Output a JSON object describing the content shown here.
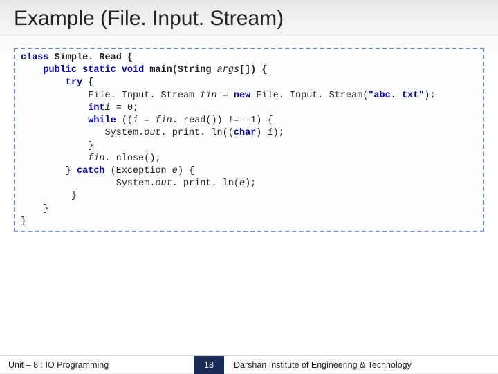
{
  "slide": {
    "title": "Example (File. Input. Stream)"
  },
  "code": {
    "l1a": "class",
    "l1b": " Simple. Read {",
    "l2a": "    public static void",
    "l2b": " main(String ",
    "l2c": "args",
    "l2d": "[]) {",
    "l3a": "        try",
    "l3b": " {",
    "l4a": "            File. Input. Stream ",
    "l4b": "fin",
    "l4c": " = ",
    "l4d": "new",
    "l4e": " File. Input. Stream(",
    "l4f": "\"abc. txt\"",
    "l4g": ");",
    "l5a": "            int",
    "l5b": " i",
    "l5c": " = 0;",
    "l5d": "i",
    "l6a": "            while",
    "l6b": " ((",
    "l6c": "i",
    "l6d": " = ",
    "l6e": "fin",
    "l6f": ". read()) != -1) {",
    "l7a": "               System.",
    "l7b": "out",
    "l7c": ". print. ln((",
    "l7d": "char",
    "l7e": ") ",
    "l7f": "i",
    "l7g": ");",
    "l8": "            }",
    "l9a": "            ",
    "l9b": "fin",
    "l9c": ". close();",
    "l10a": "        } ",
    "l10b": "catch",
    "l10c": " (Exception ",
    "l10d": "e",
    "l10e": ") {",
    "l11a": "                 System.",
    "l11b": "out",
    "l11c": ". print. ln(",
    "l11d": "e",
    "l11e": ");",
    "l12": "         }",
    "l13": "    }",
    "l14": "}"
  },
  "footer": {
    "unit": "Unit – 8 : IO Programming",
    "page": "18",
    "institute": "Darshan Institute of Engineering & Technology"
  }
}
